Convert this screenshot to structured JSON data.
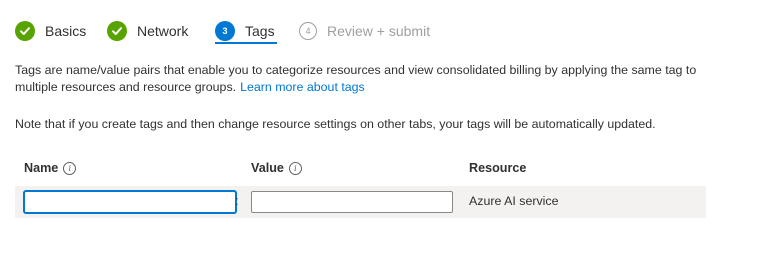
{
  "steps": [
    {
      "label": "Basics",
      "state": "done",
      "icon": "checkmark-icon"
    },
    {
      "label": "Network",
      "state": "done",
      "icon": "checkmark-icon"
    },
    {
      "label": "Tags",
      "state": "current",
      "number": "3"
    },
    {
      "label": "Review + submit",
      "state": "future",
      "number": "4"
    }
  ],
  "description": {
    "text": "Tags are name/value pairs that enable you to categorize resources and view consolidated billing by applying the same tag to multiple resources and resource groups.",
    "link": "Learn more about tags"
  },
  "note": "Note that if you create tags and then change resource settings on other tabs, your tags will be automatically updated.",
  "table": {
    "headers": {
      "name": "Name",
      "value": "Value",
      "resource": "Resource"
    },
    "info_glyph": "i",
    "separator": ":",
    "row": {
      "name_value": "",
      "value_value": "",
      "resource": "Azure AI service"
    }
  },
  "colors": {
    "accent": "#0078d4",
    "success": "#57a300",
    "row_background": "#f3f2f1",
    "muted": "#a19f9d"
  }
}
